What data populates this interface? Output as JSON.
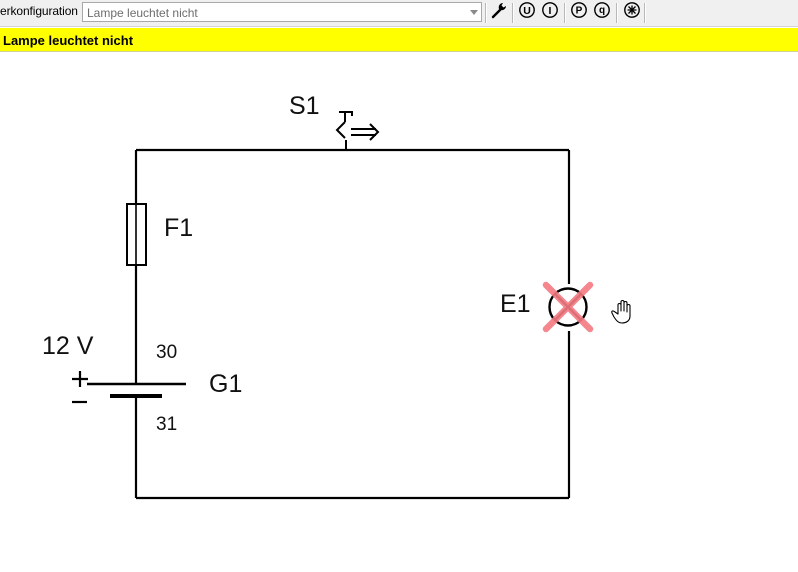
{
  "toolbar": {
    "label": "erkonfiguration",
    "configuration_value": "Lampe leuchtet nicht",
    "buttons": {
      "tools": "wrench-icon",
      "voltage": "U",
      "current": "I",
      "power": "P",
      "charge": "q",
      "lamp": "lamp-icon"
    }
  },
  "status": {
    "message": "Lampe leuchtet nicht",
    "color": "#ffff00"
  },
  "circuit": {
    "switch_label": "S1",
    "fuse_label": "F1",
    "lamp_label": "E1",
    "lamp_state": "defective",
    "battery_label": "G1",
    "battery_voltage": "12 V",
    "terminal_positive": "30",
    "terminal_negative": "31",
    "plus_sign": "+",
    "minus_sign": "−",
    "fault_color": "#f47a82"
  }
}
